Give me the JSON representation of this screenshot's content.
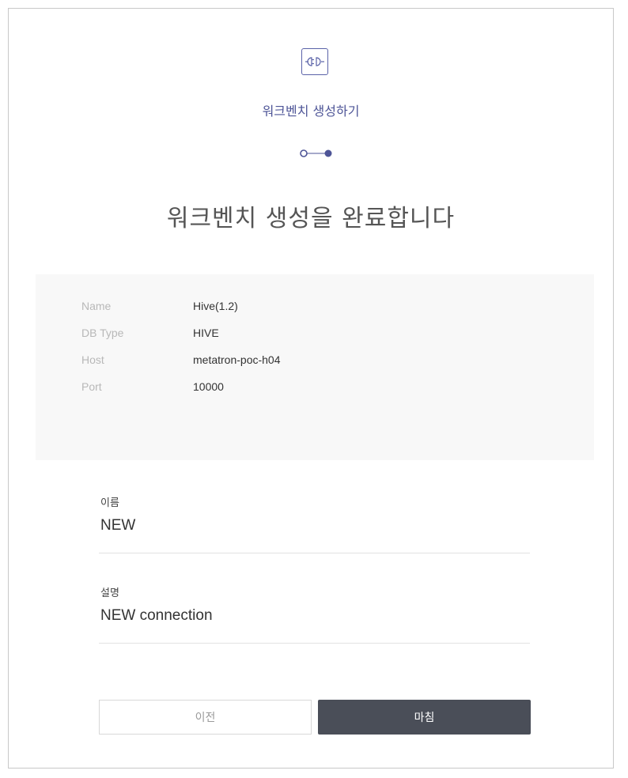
{
  "header": {
    "title": "워크벤치 생성하기",
    "icon": "connection-plug-icon"
  },
  "steps": {
    "total": 2,
    "current": 2
  },
  "main": {
    "heading": "워크벤치 생성을 완료합니다"
  },
  "summary": [
    {
      "label": "Name",
      "value": "Hive(1.2)"
    },
    {
      "label": "DB Type",
      "value": "HIVE"
    },
    {
      "label": "Host",
      "value": "metatron-poc-h04"
    },
    {
      "label": "Port",
      "value": "10000"
    }
  ],
  "form": {
    "name_label": "이름",
    "name_value": "NEW",
    "description_label": "설명",
    "description_value": "NEW connection"
  },
  "buttons": {
    "prev_label": "이전",
    "finish_label": "마침"
  },
  "colors": {
    "accent": "#4e5597",
    "finish_button": "#4a4e58",
    "summary_bg": "#f8f8f8"
  }
}
